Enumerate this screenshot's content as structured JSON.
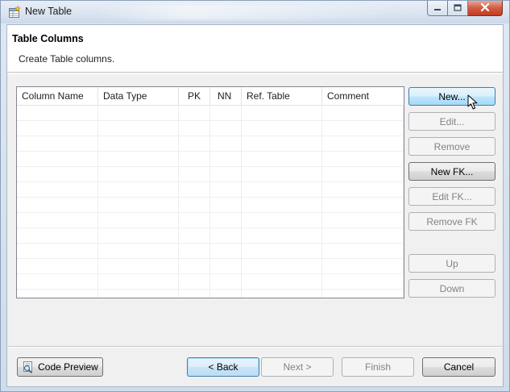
{
  "window": {
    "title": "New Table",
    "icons": {
      "app": "table-wizard-icon",
      "minimize": "minimize-icon",
      "maximize": "maximize-icon",
      "close": "close-icon"
    }
  },
  "page": {
    "title": "Table Columns",
    "description": "Create Table columns."
  },
  "table": {
    "columns": [
      "Column Name",
      "Data Type",
      "PK",
      "NN",
      "Ref. Table",
      "Comment"
    ],
    "rows": []
  },
  "side_buttons": {
    "new": "New...",
    "edit": "Edit...",
    "remove": "Remove",
    "new_fk": "New FK...",
    "edit_fk": "Edit FK...",
    "remove_fk": "Remove FK",
    "up": "Up",
    "down": "Down"
  },
  "footer": {
    "code_preview": "Code Preview",
    "back": "< Back",
    "next": "Next >",
    "finish": "Finish",
    "cancel": "Cancel"
  },
  "colors": {
    "hover_accent": "#3c7fb1",
    "disabled_text": "#838383",
    "close_button": "#c13b21"
  }
}
